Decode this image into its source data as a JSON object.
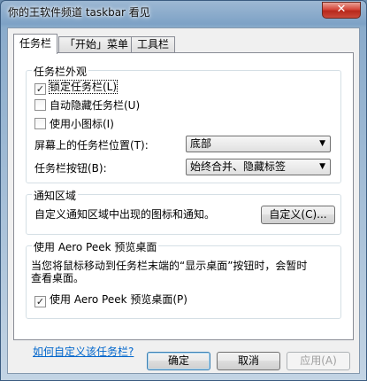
{
  "window": {
    "title": "你的王软件频道 taskbar 看见",
    "close_glyph": "✕"
  },
  "tabs": [
    {
      "label": "任务栏"
    },
    {
      "label": "「开始」菜单"
    },
    {
      "label": "工具栏"
    }
  ],
  "appearance": {
    "title": "任务栏外观",
    "lock": {
      "label": "锁定任务栏(L)",
      "checked": true,
      "check_glyph": "✓"
    },
    "autohide": {
      "label": "自动隐藏任务栏(U)",
      "checked": false
    },
    "small_icons": {
      "label": "使用小图标(I)",
      "checked": false
    },
    "location_label": "屏幕上的任务栏位置(T):",
    "location_value": "底部",
    "buttons_label": "任务栏按钮(B):",
    "buttons_value": "始终合并、隐藏标签"
  },
  "notification": {
    "title": "通知区域",
    "description": "自定义通知区域中出现的图标和通知。",
    "customize_button": "自定义(C)..."
  },
  "peek": {
    "title": "使用 Aero Peek 预览桌面",
    "description_line1": "当您将鼠标移动到任务栏末端的“显示桌面”按钮时，会暂时",
    "description_line2": "查看桌面。",
    "checkbox_label": "使用 Aero Peek 预览桌面(P)",
    "checked": true,
    "check_glyph": "✓"
  },
  "help_link": "如何自定义该任务栏?",
  "footer": {
    "ok": "确定",
    "cancel": "取消",
    "apply": "应用(A)"
  },
  "icons": {
    "dropdown_arrow": "▼"
  }
}
